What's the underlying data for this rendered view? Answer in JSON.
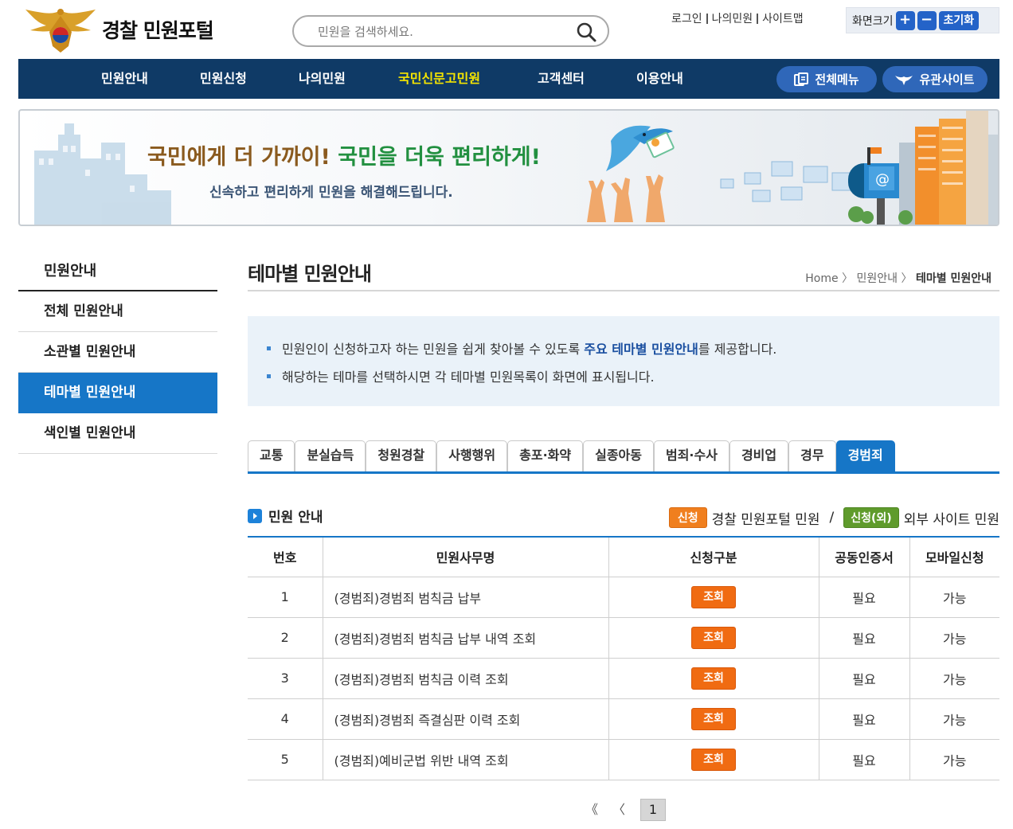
{
  "header": {
    "site_title": "경찰 민원포털",
    "search_placeholder": "민원을 검색하세요.",
    "util_links": [
      "로그인",
      "나의민원",
      "사이트맵"
    ],
    "zoom_label": "화면크기",
    "zoom_in": "+",
    "zoom_out": "−",
    "zoom_reset": "초기화"
  },
  "gnb": {
    "menus": [
      "민원안내",
      "민원신청",
      "나의민원",
      "국민신문고민원",
      "고객센터",
      "이용안내"
    ],
    "active_index": 3,
    "all_menu": "전체메뉴",
    "related_sites": "유관사이트"
  },
  "banner": {
    "title_part1": "국민에게 더 가까이! ",
    "title_part2": "국민을 더욱 편리하게!",
    "subtitle": "신속하고 편리하게 민원을 해결해드립니다."
  },
  "lnb": {
    "title": "민원안내",
    "items": [
      "전체 민원안내",
      "소관별 민원안내",
      "테마별 민원안내",
      "색인별 민원안내"
    ],
    "active_index": 2
  },
  "page": {
    "title": "테마별 민원안내",
    "breadcrumb": [
      "Home",
      "민원안내",
      "테마별 민원안내"
    ],
    "info_line1_pre": "민원인이 신청하고자 하는 민원을 쉽게 찾아볼 수 있도록 ",
    "info_line1_hl1": "주요 ",
    "info_line1_hl2": "테마별 민원안내",
    "info_line1_post": "를 제공합니다.",
    "info_line2": "해당하는 테마를 선택하시면 각 테마별 민원목록이 화면에 표시됩니다."
  },
  "tabs": {
    "items": [
      "교통",
      "분실습득",
      "청원경찰",
      "사행행위",
      "총포·화약",
      "실종아동",
      "범죄·수사",
      "경비업",
      "경무",
      "경범죄"
    ],
    "active_index": 9
  },
  "section": {
    "title": "민원 안내",
    "legend_tag1": "신청",
    "legend_text1": "경찰 민원포털 민원",
    "legend_slash": "/",
    "legend_tag2": "신청(외)",
    "legend_text2": "외부 사이트 민원"
  },
  "table": {
    "headers": [
      "번호",
      "민원사무명",
      "신청구분",
      "공동인증서",
      "모바일신청"
    ],
    "rows": [
      {
        "no": "1",
        "name": "(경범죄)경범죄 범칙금 납부",
        "type": "조회",
        "cert": "필요",
        "mobile": "가능"
      },
      {
        "no": "2",
        "name": "(경범죄)경범죄 범칙금 납부 내역 조회",
        "type": "조회",
        "cert": "필요",
        "mobile": "가능"
      },
      {
        "no": "3",
        "name": "(경범죄)경범죄 범칙금 이력 조회",
        "type": "조회",
        "cert": "필요",
        "mobile": "가능"
      },
      {
        "no": "4",
        "name": "(경범죄)경범죄 즉결심판 이력 조회",
        "type": "조회",
        "cert": "필요",
        "mobile": "가능"
      },
      {
        "no": "5",
        "name": "(경범죄)예비군법 위반 내역 조회",
        "type": "조회",
        "cert": "필요",
        "mobile": "가능"
      }
    ]
  },
  "paging": {
    "first": "《",
    "prev": "〈",
    "current": "1"
  },
  "colors": {
    "gnb_bg": "#0f3a66",
    "accent_blue": "#1676c7",
    "active_menu": "#f5e500",
    "btn_orange": "#f06b12"
  }
}
